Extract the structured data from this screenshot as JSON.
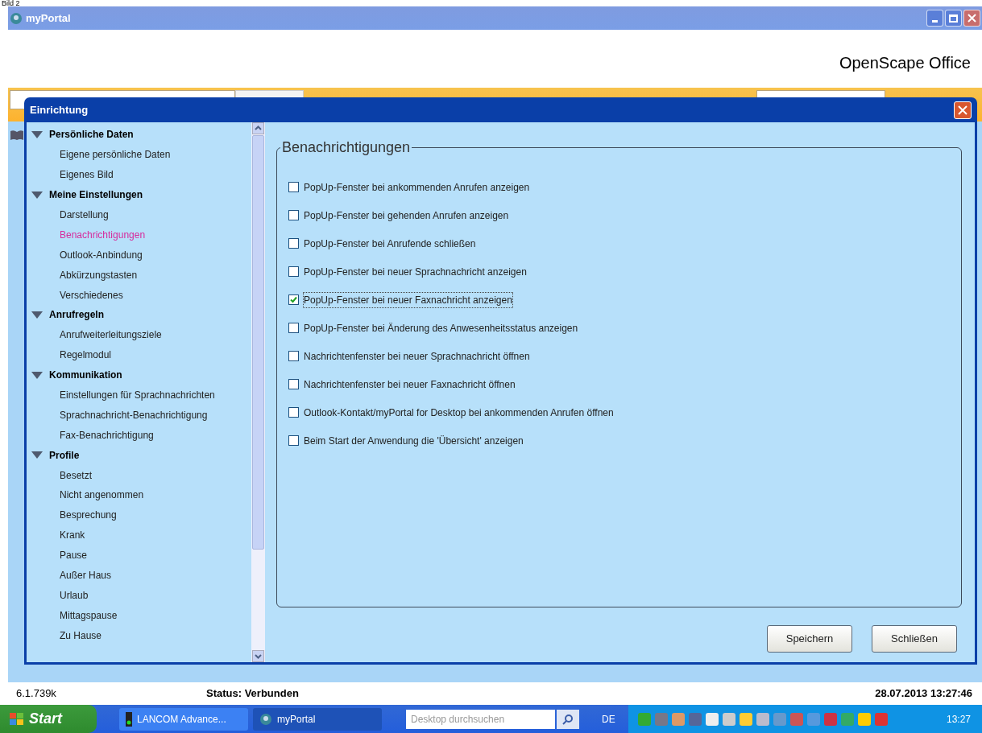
{
  "caption": "Bild 2",
  "window": {
    "title": "myPortal",
    "brand": "OpenScape Office"
  },
  "dialog": {
    "title": "Einrichtung",
    "sidebar": {
      "groups": [
        {
          "label": "Persönliche Daten",
          "expanded": true,
          "children": [
            {
              "label": "Eigene persönliche Daten",
              "selected": false
            },
            {
              "label": "Eigenes Bild",
              "selected": false
            }
          ]
        },
        {
          "label": "Meine Einstellungen",
          "expanded": true,
          "children": [
            {
              "label": "Darstellung",
              "selected": false
            },
            {
              "label": "Benachrichtigungen",
              "selected": true
            },
            {
              "label": "Outlook-Anbindung",
              "selected": false
            },
            {
              "label": "Abkürzungstasten",
              "selected": false
            },
            {
              "label": "Verschiedenes",
              "selected": false
            }
          ]
        },
        {
          "label": "Anrufregeln",
          "expanded": true,
          "children": [
            {
              "label": "Anrufweiterleitungsziele",
              "selected": false
            },
            {
              "label": "Regelmodul",
              "selected": false
            }
          ]
        },
        {
          "label": "Kommunikation",
          "expanded": true,
          "children": [
            {
              "label": "Einstellungen für Sprachnachrichten",
              "selected": false
            },
            {
              "label": "Sprachnachricht-Benachrichtigung",
              "selected": false
            },
            {
              "label": "Fax-Benachrichtigung",
              "selected": false
            }
          ]
        },
        {
          "label": "Profile",
          "expanded": true,
          "children": [
            {
              "label": "Besetzt",
              "selected": false
            },
            {
              "label": "Nicht angenommen",
              "selected": false
            },
            {
              "label": "Besprechung",
              "selected": false
            },
            {
              "label": "Krank",
              "selected": false
            },
            {
              "label": "Pause",
              "selected": false
            },
            {
              "label": "Außer Haus",
              "selected": false
            },
            {
              "label": "Urlaub",
              "selected": false
            },
            {
              "label": "Mittagspause",
              "selected": false
            },
            {
              "label": "Zu Hause",
              "selected": false
            }
          ]
        }
      ]
    },
    "panel": {
      "title": "Benachrichtigungen",
      "options": [
        {
          "label": "PopUp-Fenster bei ankommenden Anrufen anzeigen",
          "checked": false
        },
        {
          "label": "PopUp-Fenster bei gehenden Anrufen anzeigen",
          "checked": false
        },
        {
          "label": "PopUp-Fenster bei Anrufende schließen",
          "checked": false
        },
        {
          "label": "PopUp-Fenster bei neuer Sprachnachricht anzeigen",
          "checked": false
        },
        {
          "label": "PopUp-Fenster bei neuer Faxnachricht anzeigen",
          "checked": true
        },
        {
          "label": "PopUp-Fenster bei Änderung des Anwesenheitsstatus anzeigen",
          "checked": false
        },
        {
          "label": "Nachrichtenfenster bei neuer Sprachnachricht öffnen",
          "checked": false
        },
        {
          "label": "Nachrichtenfenster bei neuer Faxnachricht öffnen",
          "checked": false
        },
        {
          "label": "Outlook-Kontakt/myPortal for Desktop bei ankommenden Anrufen öffnen",
          "checked": false
        },
        {
          "label": "Beim Start der Anwendung die 'Übersicht' anzeigen",
          "checked": false
        }
      ]
    },
    "buttons": [
      "Speichern",
      "Schließen"
    ]
  },
  "status_bar": {
    "version": "6.1.739k",
    "status": "Status: Verbunden",
    "datetime": "28.07.2013 13:27:46"
  },
  "taskbar": {
    "start": "Start",
    "tasks": [
      {
        "label": "LANCOM Advance...",
        "selected": false
      },
      {
        "label": "myPortal",
        "selected": true
      }
    ],
    "search": {
      "placeholder": "Desktop durchsuchen"
    },
    "language": "DE",
    "clock": "13:27"
  }
}
